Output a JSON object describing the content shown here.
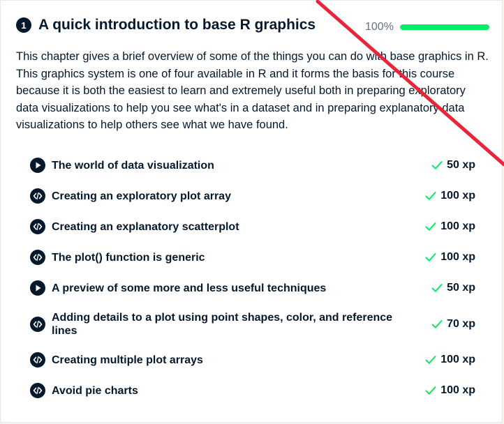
{
  "chapter": {
    "number": "1",
    "title": "A quick introduction to base R graphics",
    "progress_label": "100%",
    "progress_fraction": 1.0,
    "description": "This chapter gives a brief overview of some of the things you can do with base graphics in R. This graphics system is one of four available in R and it forms the basis for this course because it is both the easiest to learn and extremely useful both in preparing exploratory data visualizations to help you see what's in a dataset and in preparing explanatory data visualizations to help others see what we have found."
  },
  "exercises": [
    {
      "title": "The world of data visualization",
      "xp": "50 xp",
      "type": "video",
      "icon": "play-icon"
    },
    {
      "title": "Creating an exploratory plot array",
      "xp": "100 xp",
      "type": "code",
      "icon": "code-icon"
    },
    {
      "title": "Creating an explanatory scatterplot",
      "xp": "100 xp",
      "type": "code",
      "icon": "code-icon"
    },
    {
      "title": "The plot() function is generic",
      "xp": "100 xp",
      "type": "code",
      "icon": "code-icon"
    },
    {
      "title": "A preview of some more and less useful techniques",
      "xp": "50 xp",
      "type": "video",
      "icon": "play-icon"
    },
    {
      "title": "Adding details to a plot using point shapes, color, and reference lines",
      "xp": "70 xp",
      "type": "code",
      "icon": "code-icon"
    },
    {
      "title": "Creating multiple plot arrays",
      "xp": "100 xp",
      "type": "code",
      "icon": "code-icon"
    },
    {
      "title": "Avoid pie charts",
      "xp": "100 xp",
      "type": "code",
      "icon": "code-icon"
    }
  ],
  "colors": {
    "navy": "#05192d",
    "progress_green": "#03ef62",
    "check_green": "#03ef62",
    "strike_red": "#e8253a"
  }
}
